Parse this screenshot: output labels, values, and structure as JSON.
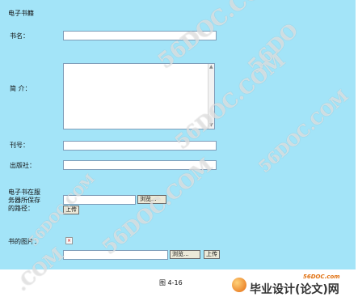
{
  "form": {
    "title": "电子书籍",
    "fields": {
      "book_name": {
        "label": "书名：",
        "value": ""
      },
      "intro": {
        "label": "简 介：",
        "value": ""
      },
      "issue_no": {
        "label": "刊号：",
        "value": ""
      },
      "publisher": {
        "label": "出版社：",
        "value": ""
      },
      "server_path": {
        "label": "电子书在服务器所保存的路径：",
        "value": "",
        "browse_label": "浏览...",
        "upload_label": "上传"
      },
      "cover_image": {
        "label": "书的图片：",
        "value": "",
        "browse_label": "浏览...",
        "upload_label": "上传"
      }
    }
  },
  "caption": "图 4-16",
  "watermarks": {
    "text": "56DOC.COM",
    "short": ".COM",
    "tail": "56DO"
  },
  "logo": {
    "domain": "56DOC.com",
    "title": "毕业设计(论文)网"
  },
  "colors": {
    "panel_background": "#a3e4f8",
    "page_background": "#ffffff",
    "logo_accent": "#e07010"
  }
}
